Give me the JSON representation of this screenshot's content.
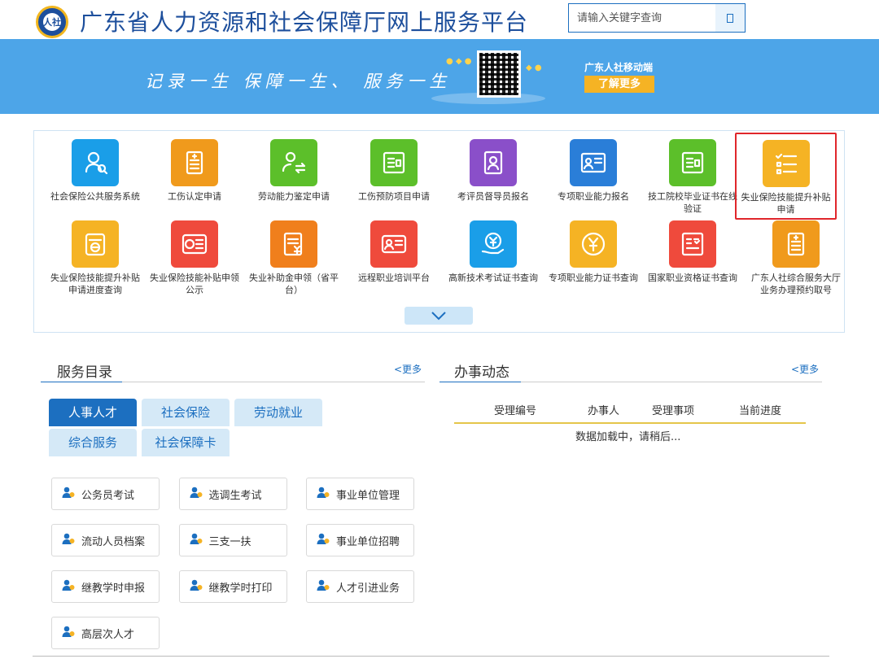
{
  "header": {
    "logo_text": "人社",
    "title": "广东省人力资源和社会保障厅网上服务平台",
    "search_placeholder": "请输入关键字查询"
  },
  "banner": {
    "slogan": "记录一生 保障一生、 服务一生",
    "mobile_label": "广东人社移动端",
    "learn_more": "了解更多"
  },
  "services": [
    {
      "label": "社会保险公共服务系统",
      "icon": "user-search-icon",
      "color": "#1a9ee8"
    },
    {
      "label": "工伤认定申请",
      "icon": "document-plus-icon",
      "color": "#f09a1c"
    },
    {
      "label": "劳动能力鉴定申请",
      "icon": "users-exchange-icon",
      "color": "#5cbf2a"
    },
    {
      "label": "工伤预防项目申请",
      "icon": "certificate-icon",
      "color": "#5cbf2a"
    },
    {
      "label": "考评员督导员报名",
      "icon": "id-badge-icon",
      "color": "#8a4fc9"
    },
    {
      "label": "专项职业能力报名",
      "icon": "profile-card-icon",
      "color": "#2a7ed8"
    },
    {
      "label": "技工院校毕业证书在线验证",
      "icon": "certificate-icon",
      "color": "#5cbf2a"
    },
    {
      "label": "失业保险技能提升补贴申请",
      "icon": "checklist-icon",
      "color": "#f5b324",
      "highlighted": true
    },
    {
      "label": "失业保险技能提升补贴申请进度查询",
      "icon": "progress-doc-icon",
      "color": "#f5b324"
    },
    {
      "label": "失业保险技能补贴申领公示",
      "icon": "card-list-icon",
      "color": "#ef4a3c"
    },
    {
      "label": "失业补助金申领（省平台）",
      "icon": "yuan-doc-icon",
      "color": "#f07f1c"
    },
    {
      "label": "远程职业培训平台",
      "icon": "id-card-icon",
      "color": "#ef4a3c"
    },
    {
      "label": "高新技术考试证书查询",
      "icon": "yuan-hand-icon",
      "color": "#1a9ee8"
    },
    {
      "label": "专项职业能力证书查询",
      "icon": "yuan-circle-icon",
      "color": "#f5b324"
    },
    {
      "label": "国家职业资格证书查询",
      "icon": "qualification-icon",
      "color": "#ef4a3c"
    },
    {
      "label": "广东人社综合服务大厅业务办理预约取号",
      "icon": "document-plus-icon",
      "color": "#f09a1c"
    }
  ],
  "catalog": {
    "title": "服务目录",
    "more": "<更多",
    "tabs": [
      "人事人才",
      "社会保险",
      "劳动就业",
      "综合服务",
      "社会保障卡"
    ],
    "active_tab": "人事人才",
    "items": [
      "公务员考试",
      "选调生考试",
      "事业单位管理",
      "流动人员档案",
      "三支一扶",
      "事业单位招聘",
      "继教学时申报",
      "继教学时打印",
      "人才引进业务",
      "高层次人才"
    ]
  },
  "activity": {
    "title": "办事动态",
    "more": "<更多",
    "columns": [
      "受理编号",
      "办事人",
      "受理事项",
      "当前进度"
    ],
    "loading_text": "数据加载中，请稍后..."
  },
  "colors": {
    "primary": "#1c6fc0",
    "banner": "#4da5e8",
    "highlight_border": "#e0262b",
    "tab_inactive": "#d5e9f7",
    "activity_line": "#e5c64a"
  }
}
